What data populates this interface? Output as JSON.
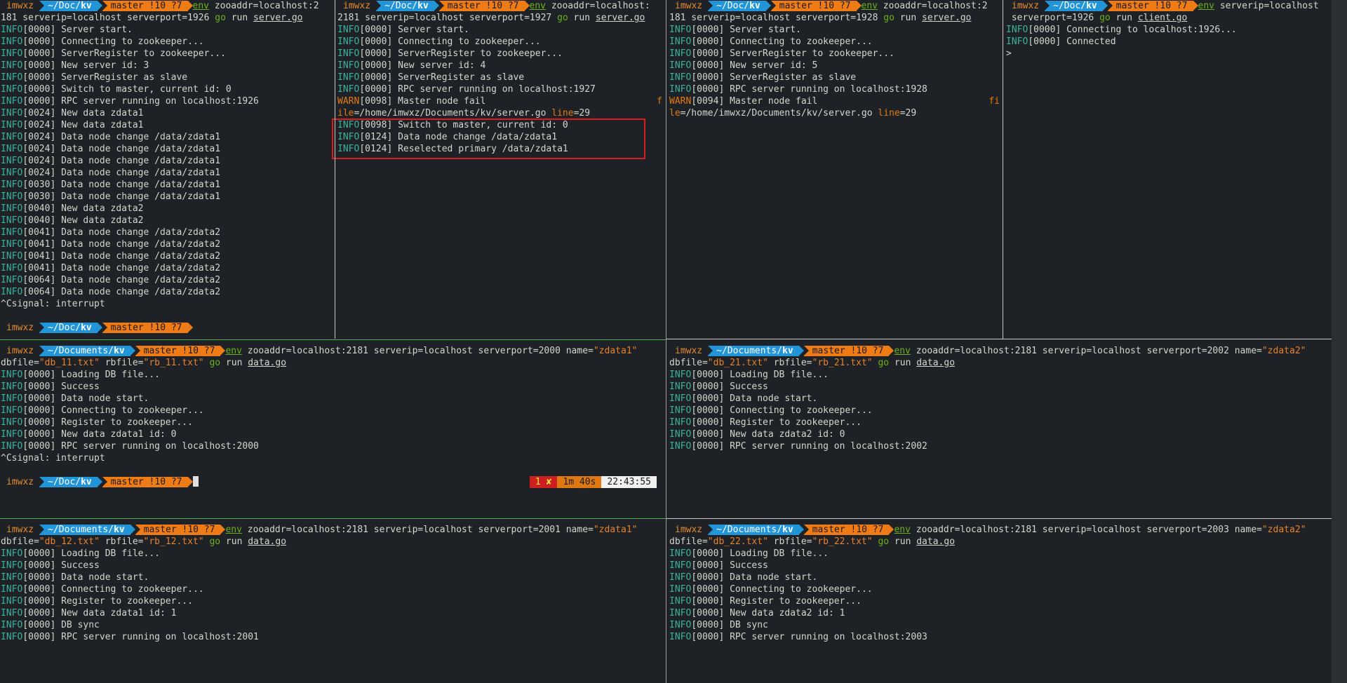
{
  "prompt": {
    "user": "imwxz",
    "git": "master !10 ?7"
  },
  "pane_server1": {
    "path": "~/Doc/",
    "path_bold": "kv",
    "cmd_env": "env",
    "cmd_line1_rest": " zooaddr=localhost:2",
    "cmd_line2_pre": "181 serverip=localhost serverport=1926 ",
    "cmd_go": "go",
    "cmd_run": " run ",
    "cmd_file": "server.go",
    "logs": [
      "[0000] Server start.",
      "[0000] Connecting to zookeeper...",
      "[0000] ServerRegister to zookeeper...",
      "[0000] New server id: 3",
      "[0000] ServerRegister as slave",
      "[0000] Switch to master, current id: 0",
      "[0000] RPC server running on localhost:1926",
      "[0024] New data zdata1",
      "[0024] New data zdata1",
      "[0024] Data node change /data/zdata1",
      "[0024] Data node change /data/zdata1",
      "[0024] Data node change /data/zdata1",
      "[0024] Data node change /data/zdata1",
      "[0030] Data node change /data/zdata1",
      "[0030] Data node change /data/zdata1",
      "[0040] New data zdata2",
      "[0040] New data zdata2",
      "[0041] Data node change /data/zdata2",
      "[0041] Data node change /data/zdata2",
      "[0041] Data node change /data/zdata2",
      "[0041] Data node change /data/zdata2",
      "[0064] Data node change /data/zdata2",
      "[0064] Data node change /data/zdata2"
    ],
    "interrupt": "^Csignal: interrupt",
    "prompt2_path": "~/Doc/",
    "prompt2_bold": "kv"
  },
  "pane_server2": {
    "path": "~/Doc/",
    "path_bold": "kv",
    "cmd_env": "env",
    "cmd_line1_rest": " zooaddr=localhost:",
    "cmd_line2_pre": "2181 serverip=localhost serverport=1927 ",
    "cmd_go": "go",
    "cmd_run": " run ",
    "cmd_file": "server.go",
    "logs": [
      "[0000] Server start.",
      "[0000] Connecting to zookeeper...",
      "[0000] ServerRegister to zookeeper...",
      "[0000] New server id: 4",
      "[0000] ServerRegister as slave",
      "[0000] RPC server running on localhost:1927"
    ],
    "warn_msg": "[0098] Master node fail",
    "warn_tail": "f",
    "warn_file_key": "ile",
    "warn_file_val": "=/home/imwxz/Documents/kv/server.go ",
    "warn_line_key": "line",
    "warn_line_val": "=29",
    "logs2": [
      "[0098] Switch to master, current id: 0",
      "[0124] Data node change /data/zdata1",
      "[0124] Reselected primary /data/zdata1"
    ]
  },
  "pane_server3": {
    "path": "~/Doc/",
    "path_bold": "kv",
    "cmd_env": "env",
    "cmd_line1_rest": " zooaddr=localhost:2",
    "cmd_line2_pre": "181 serverip=localhost serverport=1928 ",
    "cmd_go": "go",
    "cmd_run": " run ",
    "cmd_file": "server.go",
    "logs": [
      "[0000] Server start.",
      "[0000] Connecting to zookeeper...",
      "[0000] ServerRegister to zookeeper...",
      "[0000] New server id: 5",
      "[0000] ServerRegister as slave",
      "[0000] RPC server running on localhost:1928"
    ],
    "warn_msg": "[0094] Master node fail",
    "warn_tail": "fi",
    "warn_file_key": "le",
    "warn_file_val": "=/home/imwxz/Documents/kv/server.go ",
    "warn_line_key": "line",
    "warn_line_val": "=29"
  },
  "pane_client": {
    "path": "~/Doc/",
    "path_bold": "kv",
    "cmd_env": "env",
    "cmd_line1_rest": " serverip=localhost",
    "cmd_line2_pre": " serverport=1926 ",
    "cmd_go": "go",
    "cmd_run": " run ",
    "cmd_file": "client.go",
    "logs": [
      "[0000] Connecting to localhost:1926...",
      "[0000] Connected"
    ],
    "input_prompt": ">"
  },
  "pane_data11": {
    "path": "~/Documents/",
    "path_bold": "kv",
    "cmd_env": "env",
    "cmd_args": " zooaddr=localhost:2181 serverip=localhost serverport=2000 name=",
    "cmd_name": "\"zdata1\"",
    "l2_db": "dbfile=",
    "l2_db_val": "\"db_11.txt\"",
    "l2_rb": " rbfile=",
    "l2_rb_val": "\"rb_11.txt\"",
    "l2_sp": " ",
    "cmd_go": "go",
    "cmd_run": " run ",
    "cmd_file": "data.go",
    "logs": [
      "[0000] Loading DB file...",
      "[0000] Success",
      "[0000] Data node start.",
      "[0000] Connecting to zookeeper...",
      "[0000] Register to zookeeper...",
      "[0000] New data zdata1 id: 0",
      "[0000] RPC server running on localhost:2000"
    ],
    "interrupt": "^Csignal: interrupt",
    "prompt2_path": "~/Doc/",
    "prompt2_bold": "kv",
    "status_err": "1 ✘",
    "status_dur": "1m 40s",
    "status_time": "22:43:55"
  },
  "pane_data21": {
    "path": "~/Documents/",
    "path_bold": "kv",
    "cmd_env": "env",
    "cmd_args": " zooaddr=localhost:2181 serverip=localhost serverport=2002 name=",
    "cmd_name": "\"zdata2\"",
    "l2_db": "dbfile=",
    "l2_db_val": "\"db_21.txt\"",
    "l2_rb": " rbfile=",
    "l2_rb_val": "\"rb_21.txt\"",
    "l2_sp": " ",
    "cmd_go": "go",
    "cmd_run": " run ",
    "cmd_file": "data.go",
    "logs": [
      "[0000] Loading DB file...",
      "[0000] Success",
      "[0000] Data node start.",
      "[0000] Connecting to zookeeper...",
      "[0000] Register to zookeeper...",
      "[0000] New data zdata2 id: 0",
      "[0000] RPC server running on localhost:2002"
    ]
  },
  "pane_data12": {
    "path": "~/Documents/",
    "path_bold": "kv",
    "cmd_env": "env",
    "cmd_args": " zooaddr=localhost:2181 serverip=localhost serverport=2001 name=",
    "cmd_name": "\"zdata1\"",
    "l2_db": "dbfile=",
    "l2_db_val": "\"db_12.txt\"",
    "l2_rb": " rbfile=",
    "l2_rb_val": "\"rb_12.txt\"",
    "l2_sp": " ",
    "cmd_go": "go",
    "cmd_run": " run ",
    "cmd_file": "data.go",
    "logs": [
      "[0000] Loading DB file...",
      "[0000] Success",
      "[0000] Data node start.",
      "[0000] Connecting to zookeeper...",
      "[0000] Register to zookeeper...",
      "[0000] New data zdata1 id: 1",
      "[0000] DB sync",
      "[0000] RPC server running on localhost:2001"
    ]
  },
  "pane_data22": {
    "path": "~/Documents/",
    "path_bold": "kv",
    "cmd_env": "env",
    "cmd_args": " zooaddr=localhost:2181 serverip=localhost serverport=2003 name=",
    "cmd_name": "\"zdata2\"",
    "l2_db": "dbfile=",
    "l2_db_val": "\"db_22.txt\"",
    "l2_rb": " rbfile=",
    "l2_rb_val": "\"rb_22.txt\"",
    "l2_sp": " ",
    "cmd_go": "go",
    "cmd_run": " run ",
    "cmd_file": "data.go",
    "logs": [
      "[0000] Loading DB file...",
      "[0000] Success",
      "[0000] Data node start.",
      "[0000] Connecting to zookeeper...",
      "[0000] Register to zookeeper...",
      "[0000] New data zdata2 id: 1",
      "[0000] DB sync",
      "[0000] RPC server running on localhost:2003"
    ]
  },
  "level_info": "INFO",
  "level_warn": "WARN",
  "colors": {
    "info": "#3bb29f",
    "warn": "#e47b12",
    "path_bg": "#2295d9",
    "git_bg": "#ee7b15",
    "highlight": "#d81e1e",
    "divider_h": "#4caf50"
  }
}
